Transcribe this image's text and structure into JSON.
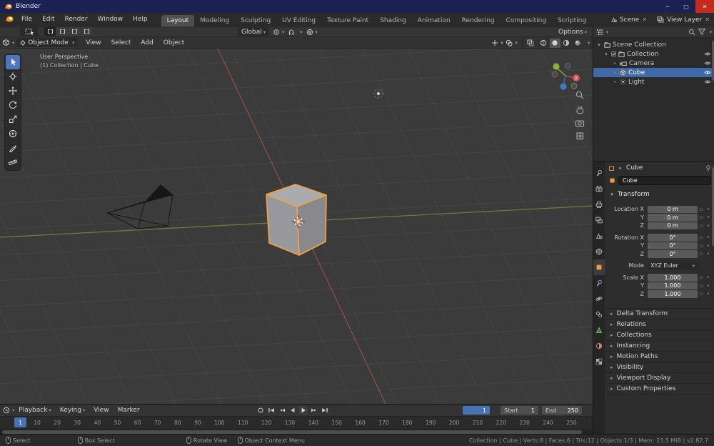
{
  "colors": {
    "accent_blue": "#4772b3",
    "selection_orange": "#f7a23c",
    "axis_x_red": "#b04f52",
    "axis_y_green": "#6e8f3f"
  },
  "titlebar": {
    "app_title": "Blender",
    "minimize_glyph": "─",
    "maximize_glyph": "□",
    "close_glyph": "✕"
  },
  "menubar": {
    "menus": [
      "File",
      "Edit",
      "Render",
      "Window",
      "Help"
    ],
    "workspaces": [
      {
        "label": "Layout",
        "active": true
      },
      {
        "label": "Modeling"
      },
      {
        "label": "Sculpting"
      },
      {
        "label": "UV Editing"
      },
      {
        "label": "Texture Paint"
      },
      {
        "label": "Shading"
      },
      {
        "label": "Animation"
      },
      {
        "label": "Rendering"
      },
      {
        "label": "Compositing"
      },
      {
        "label": "Scripting"
      }
    ],
    "scene_selector": {
      "label": "Scene"
    },
    "view_layer_selector": {
      "label": "View Layer"
    }
  },
  "viewport": {
    "tool_header": {
      "orientation": "Global",
      "options_label": "Options"
    },
    "header": {
      "mode": "Object Mode",
      "menus": [
        "View",
        "Select",
        "Add",
        "Object"
      ]
    },
    "overlay": {
      "perspective": "User Perspective",
      "context": "(1) Collection | Cube"
    },
    "gizmo": {
      "x_label": "X"
    }
  },
  "outliner": {
    "tree": [
      {
        "label": "Scene Collection"
      },
      {
        "label": "Collection"
      },
      {
        "label": "Camera"
      },
      {
        "label": "Cube"
      },
      {
        "label": "Light"
      }
    ]
  },
  "properties": {
    "breadcrumb": "Cube",
    "name_field": "Cube",
    "transform": {
      "title": "Transform",
      "rows": [
        {
          "label": "Location X",
          "value": "0 m",
          "cls": "group-start"
        },
        {
          "label": "Y",
          "value": "0 m"
        },
        {
          "label": "Z",
          "value": "0 m"
        },
        {
          "label": "Rotation X",
          "value": "0°",
          "cls": "group-start"
        },
        {
          "label": "Y",
          "value": "0°"
        },
        {
          "label": "Z",
          "value": "0°"
        },
        {
          "label": "Mode",
          "value": "XYZ Euler",
          "cls": "dropdown group-start"
        },
        {
          "label": "Scale X",
          "value": "1.000",
          "cls": "group-start"
        },
        {
          "label": "Y",
          "value": "1.000"
        },
        {
          "label": "Z",
          "value": "1.000"
        }
      ]
    },
    "sections": [
      "Delta Transform",
      "Relations",
      "Collections",
      "Instancing",
      "Motion Paths",
      "Visibility",
      "Viewport Display",
      "Custom Properties"
    ]
  },
  "timeline": {
    "menus": [
      "Playback",
      "Keying",
      "View",
      "Marker"
    ],
    "current_frame": "1",
    "start_label": "Start",
    "start_value": "1",
    "end_label": "End",
    "end_value": "250",
    "playhead": "1",
    "ruler": [
      "1",
      "10",
      "20",
      "30",
      "40",
      "50",
      "60",
      "70",
      "80",
      "90",
      "100",
      "110",
      "120",
      "130",
      "140",
      "150",
      "160",
      "170",
      "180",
      "190",
      "200",
      "210",
      "220",
      "230",
      "240",
      "250"
    ]
  },
  "statusbar": {
    "hints": [
      "Select",
      "Box Select",
      "Rotate View",
      "Object Context Menu"
    ],
    "stats": "Collection | Cube | Verts:8 | Faces:6 | Tris:12 | Objects:1/3 | Mem: 23.5 MiB | v2.82.7"
  }
}
